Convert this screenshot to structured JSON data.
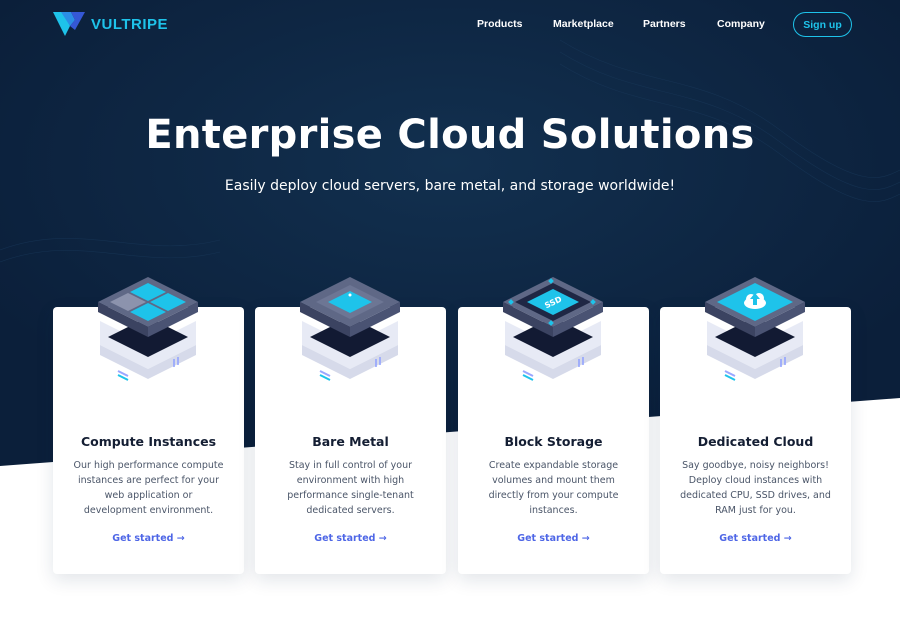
{
  "brand": {
    "name": "VULTRIPE",
    "accent": "#1ec3ea",
    "navy": "#0d2340",
    "link_color": "#4e66e6"
  },
  "nav": {
    "items": [
      {
        "label": "Products"
      },
      {
        "label": "Marketplace"
      },
      {
        "label": "Partners"
      },
      {
        "label": "Company"
      }
    ],
    "signup_label": "Sign up"
  },
  "hero": {
    "title": "Enterprise Cloud Solutions",
    "subtitle": "Easily deploy cloud servers, bare metal, and storage worldwide!"
  },
  "cards": [
    {
      "title": "Compute Instances",
      "description": "Our high performance compute instances are perfect for your web application or development environment.",
      "link": "Get started →",
      "icon": "compute-grid-icon"
    },
    {
      "title": "Bare Metal",
      "description": "Stay in full control of your environment with high performance single-tenant dedicated servers.",
      "link": "Get started →",
      "icon": "bare-metal-chip-icon"
    },
    {
      "title": "Block Storage",
      "description": "Create expandable storage volumes and mount them directly from your compute instances.",
      "link": "Get started →",
      "icon": "ssd-storage-icon",
      "icon_label": "SSD"
    },
    {
      "title": "Dedicated Cloud",
      "description": "Say goodbye, noisy neighbors! Deploy cloud instances with dedicated CPU, SSD drives, and RAM just for you.",
      "link": "Get started →",
      "icon": "cloud-upload-icon"
    }
  ]
}
